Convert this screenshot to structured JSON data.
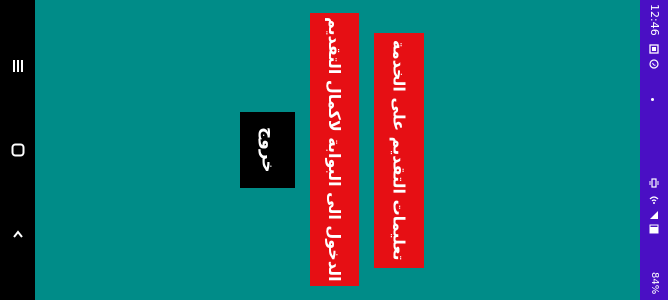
{
  "status_bar": {
    "time": "12:46",
    "battery_text": "84%",
    "icons": [
      "gallery-icon",
      "whatsapp-icon",
      "vibrate-icon",
      "wifi-icon",
      "signal-icon",
      "battery-icon"
    ]
  },
  "nav_bar": {
    "icons": [
      "menu-icon",
      "home-icon",
      "back-icon"
    ]
  },
  "main": {
    "instructions_button_label": "تعليمات التقديم على الخدمة",
    "portal_button_label": "الدخول الى البوابة لاكمال التقديم",
    "exit_button_label": "خروج"
  },
  "colors": {
    "background": "#008c88",
    "button_red": "#e60f14",
    "exit_button": "#000000",
    "status_bar": "#4a0fc4",
    "nav_bar": "#000000"
  }
}
